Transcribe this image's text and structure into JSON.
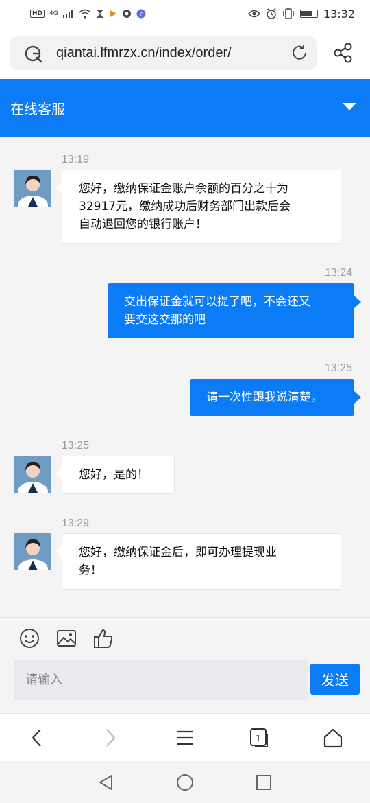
{
  "status_bar": {
    "hd": "HD",
    "signal": "4G",
    "time": "13:32",
    "icons": [
      "signal-icon",
      "wifi-icon",
      "hourglass-icon",
      "video-icon",
      "app-icon",
      "music-icon",
      "eye-icon",
      "alarm-icon",
      "vibrate-icon",
      "battery-icon"
    ]
  },
  "browser": {
    "url": "qiantai.lfmrzx.cn/index/order/",
    "icons": [
      "g-search-icon",
      "reload-icon",
      "share-icon"
    ]
  },
  "header": {
    "title": "在线客服",
    "dropdown_icon": "chevron-down-icon",
    "color": "#0b7cf5"
  },
  "messages": [
    {
      "side": "left",
      "time": "13:19",
      "lines": [
        "您好，缴纳保证金账户余额的百分之十为",
        "32917元，缴纳成功后财务部门出款后会",
        "自动退回您的银行账户！"
      ]
    },
    {
      "side": "right",
      "time": "13:24",
      "lines": [
        "交出保证金就可以提了吧，不会还又",
        "要交这交那的吧"
      ]
    },
    {
      "side": "right",
      "time": "13:25",
      "lines": [
        "请一次性跟我说清楚，"
      ]
    },
    {
      "side": "left",
      "time": "13:25",
      "lines": [
        "您好，是的！"
      ]
    },
    {
      "side": "left",
      "time": "13:29",
      "lines": [
        "您好，缴纳保证金后，即可办理提现业",
        "务！"
      ]
    }
  ],
  "composer": {
    "tools": [
      "emoji-icon",
      "image-icon",
      "thumbs-up-icon"
    ],
    "placeholder": "请输入",
    "send_label": "发送"
  },
  "browser_nav": {
    "tab_count": "1",
    "icons": [
      "back-icon",
      "forward-icon",
      "menu-icon",
      "tabs-icon",
      "home-icon"
    ]
  },
  "system_nav": {
    "icons": [
      "back-triangle-icon",
      "home-circle-icon",
      "recents-square-icon"
    ]
  }
}
